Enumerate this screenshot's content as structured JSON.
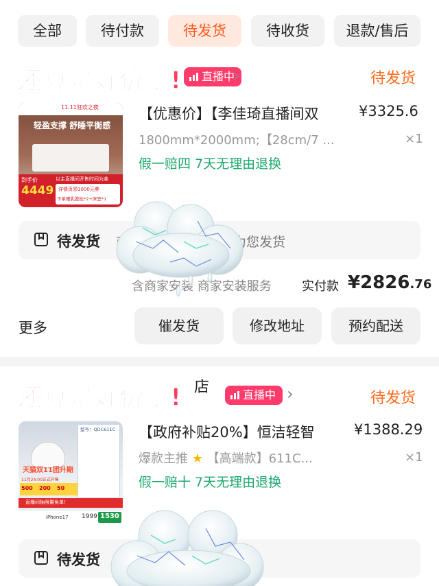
{
  "tabs": [
    {
      "label": "全部"
    },
    {
      "label": "待付款"
    },
    {
      "label": "待发货"
    },
    {
      "label": "待收货"
    },
    {
      "label": "退款/售后"
    }
  ],
  "active_tab": "待发货",
  "overlay_caption": "还算是好价吧!",
  "orders": [
    {
      "store_suffix": "直播中",
      "live_badge": "直播中",
      "status": "待发货",
      "thumb": {
        "banner_top": "11.11狂欢之夜",
        "headline": "轻盈支撑 舒睡平衡感",
        "price_tag_label": "到手价",
        "price_tag_value": "4449",
        "promo_line1": "以主直播间开售时间为准",
        "promo_line2": "详情页领1000元券",
        "promo_line3": "下单赠乳胶枕*2+床笠*1"
      },
      "title": "【优惠价】【李佳琦直播间双",
      "price": "¥3325.6",
      "spec": "1800mm*2000mm;【28cm/7 ...",
      "qty": "×1",
      "promise": "假一赔四  7天无理由退换",
      "ship_label": "待发货",
      "ship_msg": "商家正在打包，尽快为您发货",
      "service": "含商家安装  商家安装服务",
      "paid_label": "实付款",
      "paid_int": "¥2826",
      "paid_dec": ".76",
      "more_label": "更多",
      "actions": [
        "催发货",
        "修改地址",
        "预约配送"
      ]
    },
    {
      "store_suffix": "店",
      "live_badge": "直播中",
      "status": "待发货",
      "thumb": {
        "model": "型号：QDC611C",
        "banner": "天猫双11团升期",
        "promo_time": "11月24:00正式开售",
        "coupons": [
          "500",
          "200",
          "50"
        ],
        "live_tip": "直播间抽限量免单!",
        "phone": "iPhone17",
        "price": "1999",
        "final_price": "1530"
      },
      "title": "【政府补贴20%】恒洁轻智",
      "price": "¥1388.29",
      "spec": "爆款主推",
      "spec_tag": "【高端款】611C...",
      "qty": "×1",
      "promise": "假一赔十  7天无理由退换",
      "ship_label": "待发货"
    }
  ],
  "colors": {
    "accent_orange": "#ff6a1a",
    "active_tab_bg": "#ffe9df",
    "live_pink": "#ff3b6c",
    "promise_green": "#1aa86b",
    "caption_red": "#ff3b5c"
  },
  "icons": [
    "chevron-right-icon",
    "package-box-icon",
    "star-icon",
    "live-bars-icon",
    "cloud-sticker-icon"
  ]
}
